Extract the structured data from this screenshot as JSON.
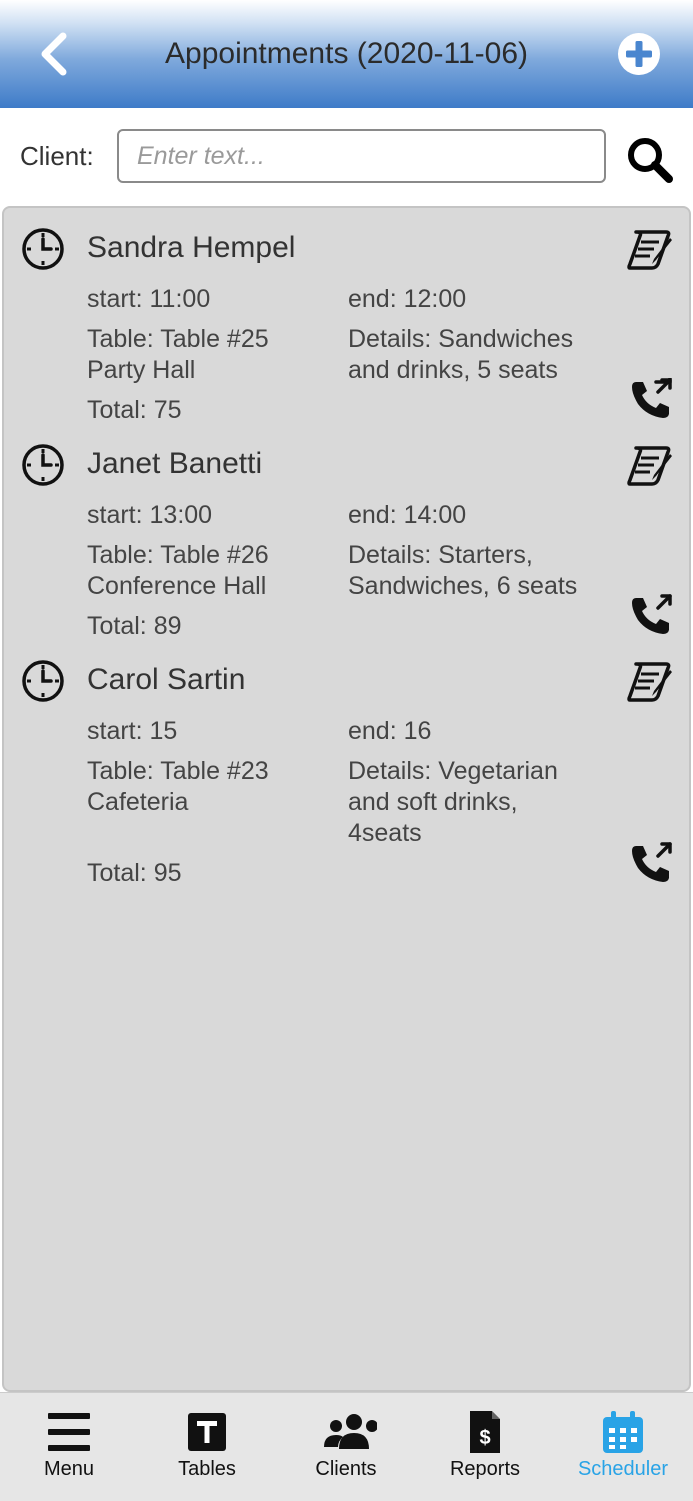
{
  "header": {
    "title": "Appointments (2020-11-06)"
  },
  "search": {
    "label": "Client:",
    "placeholder": "Enter text...",
    "value": ""
  },
  "appointments": [
    {
      "name": "Sandra Hempel",
      "start": "start: 11:00",
      "end": "end: 12:00",
      "table_line1": "Table: Table #25",
      "table_line2": "Party Hall",
      "details_line1": "Details: Sandwiches",
      "details_line2": "and drinks, 5 seats",
      "details_line3": "",
      "total": "Total: 75"
    },
    {
      "name": "Janet Banetti",
      "start": "start: 13:00",
      "end": "end: 14:00",
      "table_line1": "Table: Table #26",
      "table_line2": "Conference Hall",
      "details_line1": "Details: Starters,",
      "details_line2": "Sandwiches, 6 seats",
      "details_line3": "",
      "total": "Total: 89"
    },
    {
      "name": "Carol Sartin",
      "start": "start: 15",
      "end": "end: 16",
      "table_line1": "Table: Table #23",
      "table_line2": "Cafeteria",
      "details_line1": "Details: Vegetarian",
      "details_line2": "and soft drinks,",
      "details_line3": "4seats",
      "total": "Total: 95"
    }
  ],
  "tabbar": {
    "accent_color": "#29a3e6",
    "tabs": [
      {
        "label": "Menu",
        "icon": "hamburger-menu-icon"
      },
      {
        "label": "Tables",
        "icon": "tables-t-icon"
      },
      {
        "label": "Clients",
        "icon": "users-group-icon"
      },
      {
        "label": "Reports",
        "icon": "report-dollar-icon"
      },
      {
        "label": "Scheduler",
        "icon": "calendar-icon",
        "active": true
      }
    ]
  }
}
